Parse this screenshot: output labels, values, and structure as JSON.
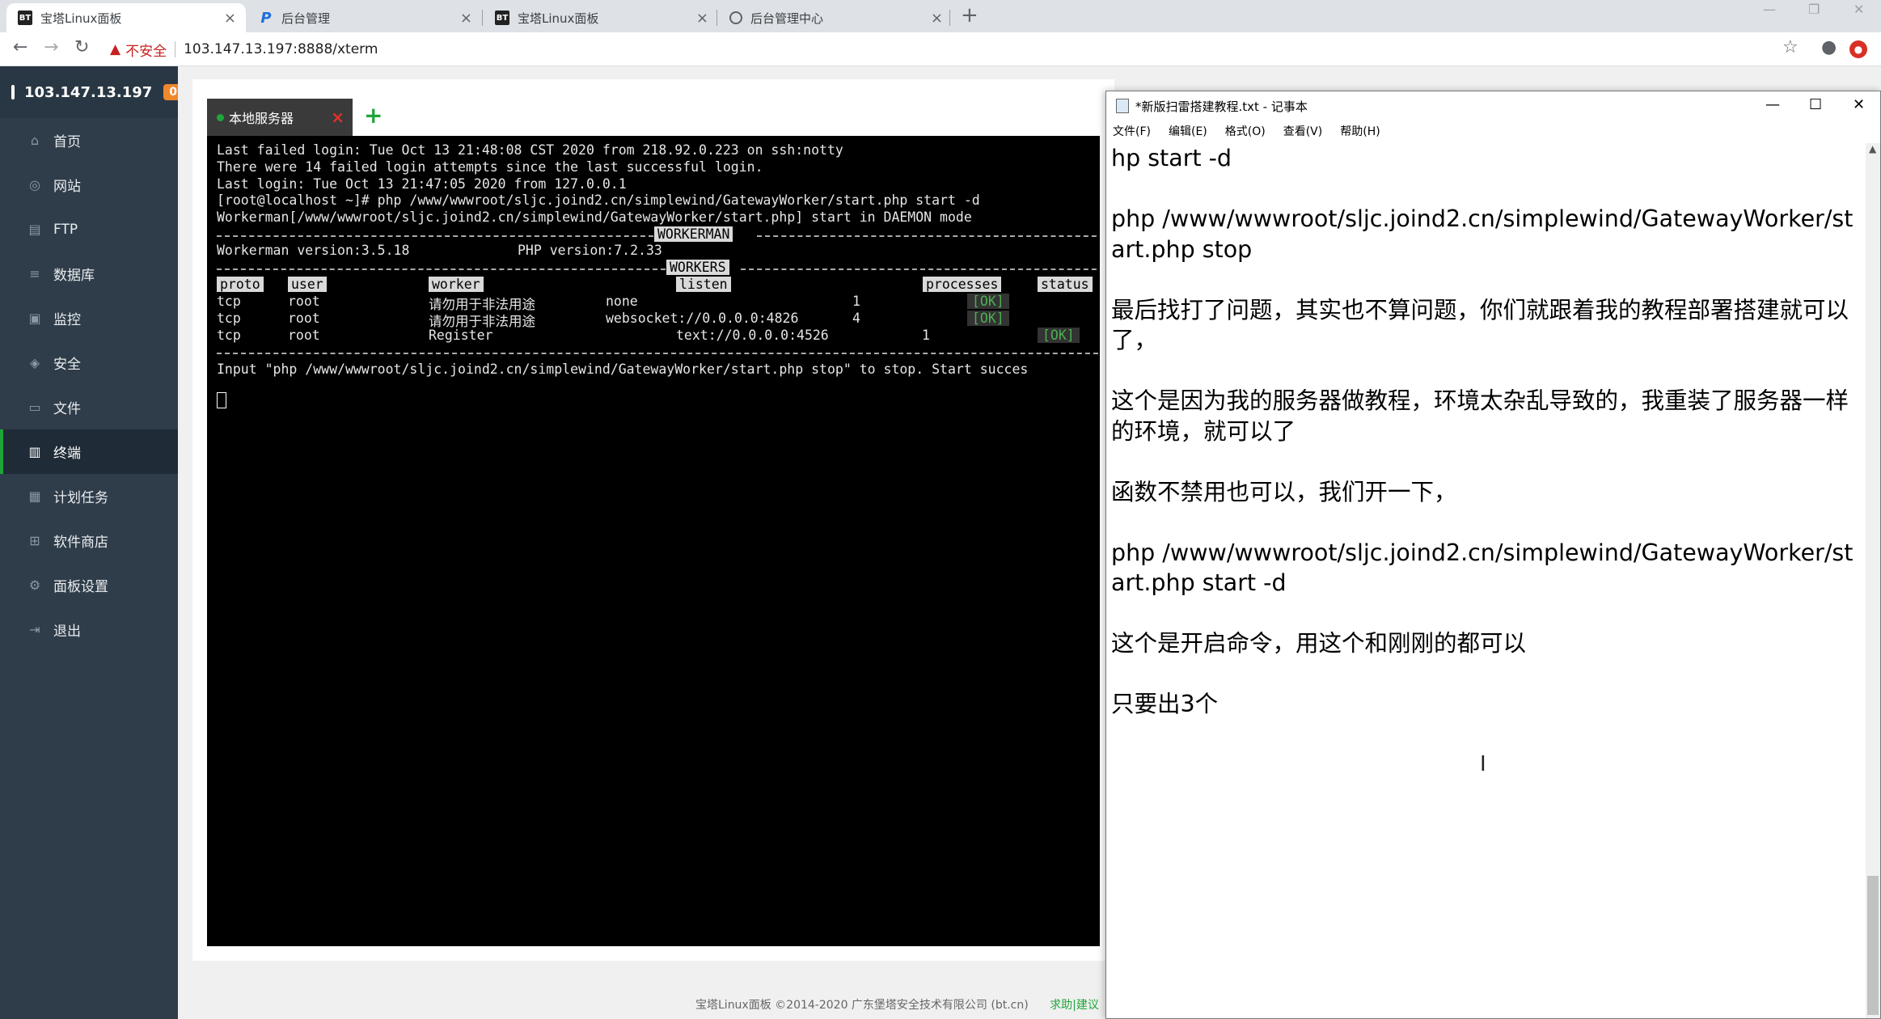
{
  "browser": {
    "tabs": [
      {
        "favicon": "BT",
        "label": "宝塔Linux面板"
      },
      {
        "favicon": "P",
        "label": "后台管理"
      },
      {
        "favicon": "BT",
        "label": "宝塔Linux面板"
      },
      {
        "favicon": "globe",
        "label": "后台管理中心"
      }
    ],
    "security_label": "不安全",
    "url": "103.147.13.197:8888/xterm"
  },
  "sidebar": {
    "server_ip": "103.147.13.197",
    "badge": "0",
    "items": [
      {
        "icon": "home-icon",
        "label": "首页"
      },
      {
        "icon": "globe-icon",
        "label": "网站"
      },
      {
        "icon": "ftp-icon",
        "label": "FTP"
      },
      {
        "icon": "database-icon",
        "label": "数据库"
      },
      {
        "icon": "monitor-icon",
        "label": "监控"
      },
      {
        "icon": "shield-icon",
        "label": "安全"
      },
      {
        "icon": "folder-icon",
        "label": "文件"
      },
      {
        "icon": "terminal-icon",
        "label": "终端",
        "active": true
      },
      {
        "icon": "calendar-icon",
        "label": "计划任务"
      },
      {
        "icon": "grid-icon",
        "label": "软件商店"
      },
      {
        "icon": "gear-icon",
        "label": "面板设置"
      },
      {
        "icon": "logout-icon",
        "label": "退出"
      }
    ]
  },
  "terminal": {
    "tab_label": "本地服务器",
    "lines": {
      "l1": "Last failed login: Tue Oct 13 21:48:08 CST 2020 from 218.92.0.223 on ssh:notty",
      "l2": "There were 14 failed login attempts since the last successful login.",
      "l3": "Last login: Tue Oct 13 21:47:05 2020 from 127.0.0.1",
      "l4": "[root@localhost ~]# php /www/wwwroot/sljc.joind2.cn/simplewind/GatewayWorker/start.php start -d",
      "l5": "Workerman[/www/wwwroot/sljc.joind2.cn/simplewind/GatewayWorker/start.php] start in DAEMON mode",
      "workerman_title": "WORKERMAN",
      "version": "Workerman version:3.5.18",
      "php_version": "PHP version:7.2.33",
      "workers_title": "WORKERS",
      "final": "Input \"php /www/wwwroot/sljc.joind2.cn/simplewind/GatewayWorker/start.php stop\" to stop. Start succes"
    },
    "headers": {
      "proto": "proto",
      "user": "user",
      "worker": "worker",
      "listen": "listen",
      "processes": "processes",
      "status": "status"
    },
    "rows": [
      {
        "proto": "tcp",
        "user": "root",
        "worker": "请勿用于非法用途",
        "listen": "none",
        "processes": "1",
        "status": "[OK]"
      },
      {
        "proto": "tcp",
        "user": "root",
        "worker": "请勿用于非法用途",
        "listen": "websocket://0.0.0.0:4826",
        "processes": "4",
        "status": "[OK]"
      },
      {
        "proto": "tcp",
        "user": "root",
        "worker": "Register",
        "listen": "text://0.0.0.0:4526",
        "processes": "1",
        "status": "[OK]"
      }
    ]
  },
  "footer": {
    "copyright": "宝塔Linux面板 ©2014-2020 广东堡塔安全技术有限公司 (bt.cn)",
    "link": "求助|建议"
  },
  "notepad": {
    "title": "*新版扫雷搭建教程.txt - 记事本",
    "menu": [
      "文件(F)",
      "编辑(E)",
      "格式(O)",
      "查看(V)",
      "帮助(H)"
    ],
    "content": "hp start -d\n\nphp /www/wwwroot/sljc.joind2.cn/simplewind/GatewayWorker/start.php stop\n\n最后找打了问题，其实也不算问题，你们就跟着我的教程部署搭建就可以了，\n\n这个是因为我的服务器做教程，环境太杂乱导致的，我重装了服务器一样的环境，就可以了\n\n函数不禁用也可以，我们开一下，\n\nphp /www/wwwroot/sljc.joind2.cn/simplewind/GatewayWorker/start.php start -d\n\n这个是开启命令，用这个和刚刚的都可以\n\n只要出3个"
  }
}
